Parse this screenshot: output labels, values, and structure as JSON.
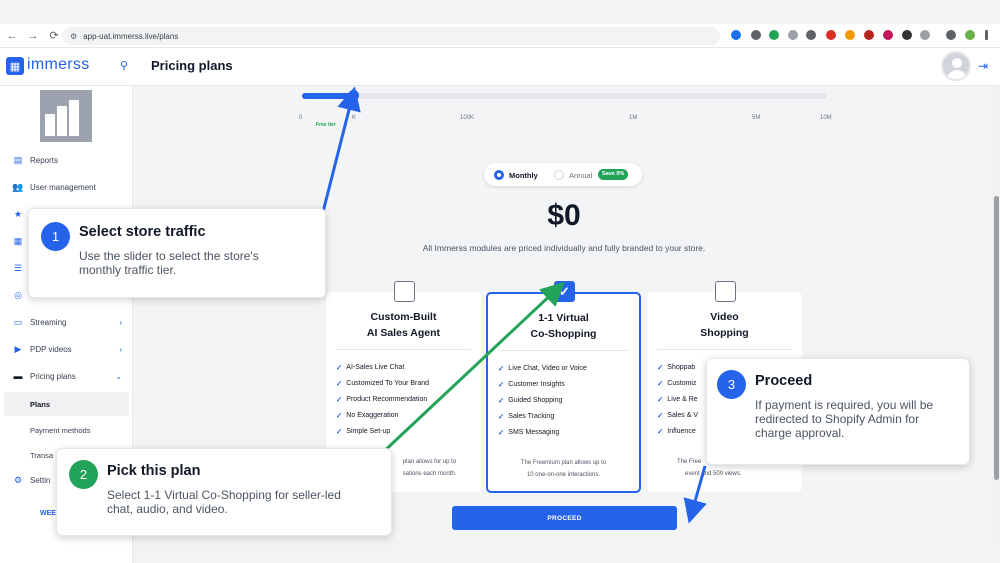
{
  "browser": {
    "url": "app-uat.immerss.live/plans",
    "back": "←",
    "forward": "→",
    "reload": "⟳"
  },
  "header": {
    "logo_text": "immerss",
    "page_title": "Pricing plans"
  },
  "sidebar": {
    "items": [
      {
        "label": "Reports",
        "icon": "report-icon",
        "glyph": "▤"
      },
      {
        "label": "User management",
        "icon": "users-icon",
        "glyph": "👥"
      },
      {
        "label": "Streaming",
        "icon": "monitor-icon",
        "glyph": "▭"
      },
      {
        "label": "PDP videos",
        "icon": "video-icon",
        "glyph": "▶"
      },
      {
        "label": "Pricing plans",
        "icon": "card-icon",
        "glyph": "▬"
      },
      {
        "label": "Plans"
      },
      {
        "label": "Payment methods"
      },
      {
        "label": "Transa"
      },
      {
        "label": "Settin",
        "icon": "gear-icon",
        "glyph": "⚙"
      }
    ],
    "week_label": "WEE"
  },
  "slider": {
    "ticks": [
      "0",
      "K",
      "100K",
      "1M",
      "5M",
      "10M"
    ],
    "free_tier": "Free tier",
    "value_fraction": 0.1
  },
  "billing_toggle": {
    "monthly": "Monthly",
    "annual": "Annual",
    "save_badge": "Save 0%",
    "selected": "Monthly"
  },
  "price": "$0",
  "description": "All Immerss modules are priced individually and fully branded to your store.",
  "plans": [
    {
      "title_line1": "Custom-Built",
      "title_line2": "AI Sales Agent",
      "selected": false,
      "features": [
        "AI-Sales Live Chat",
        "Customized To Your Brand",
        "Product Recommendation",
        "No Exaggeration",
        "Simple Set-up"
      ],
      "note_line1": "plan allows for up to",
      "note_line2": "sations each month."
    },
    {
      "title_line1": "1-1 Virtual",
      "title_line2": "Co-Shopping",
      "selected": true,
      "features": [
        "Live Chat, Video or Voice",
        "Customer Insights",
        "Guided Shopping",
        "Sales Tracking",
        "SMS Messaging"
      ],
      "note_line1": "The Freemium plan allows up to",
      "note_line2": "10 one-on-one interactions."
    },
    {
      "title_line1": "Video",
      "title_line2": "Shopping",
      "selected": false,
      "features": [
        "Shoppab",
        "Customiz",
        "Live & Re",
        "Sales & V",
        "Influence"
      ],
      "note_line1": "The Free",
      "note_line2": "event and 500 views."
    }
  ],
  "proceed_label": "PROCEED",
  "callouts": [
    {
      "number": "1",
      "title": "Select store traffic",
      "text_line1": "Use the slider to select the store's",
      "text_line2": "monthly traffic tier."
    },
    {
      "number": "2",
      "title": "Pick this plan",
      "text_line1": "Select 1-1 Virtual Co-Shopping for seller-led",
      "text_line2": "chat, audio, and video."
    },
    {
      "number": "3",
      "title": "Proceed",
      "text_line1": "If payment is required, you will be",
      "text_line2": "redirected to Shopify Admin for",
      "text_line3": "charge approval."
    }
  ],
  "colors": {
    "accent": "#2563eb",
    "green": "#22a35a"
  }
}
